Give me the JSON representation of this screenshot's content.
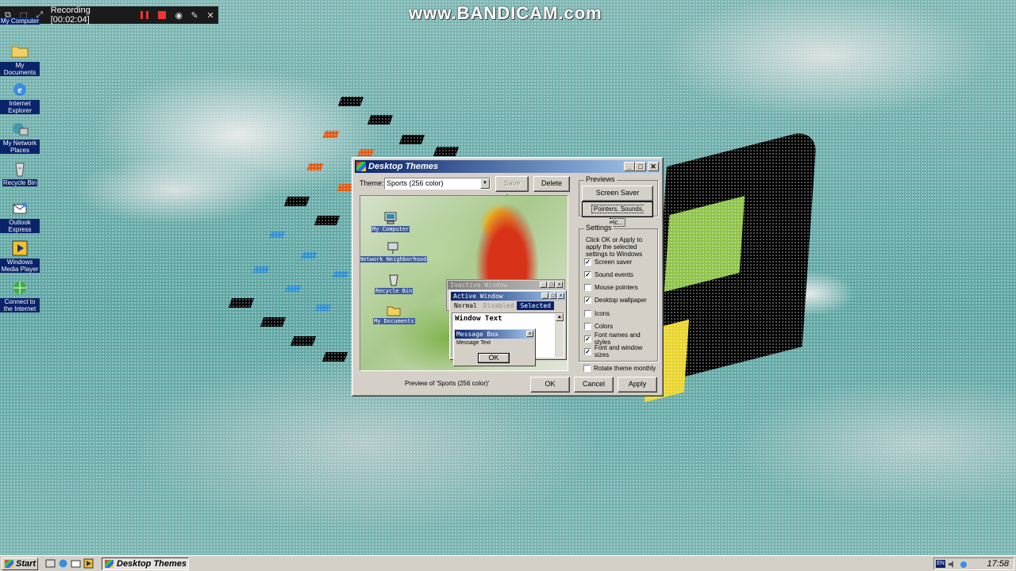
{
  "watermark": "www.BANDICAM.com",
  "recorder": {
    "status": "Recording [00:02:04]"
  },
  "desktop_icons": [
    {
      "label": "My Computer",
      "icon": "computer-icon"
    },
    {
      "label": "My Documents",
      "icon": "folder-icon"
    },
    {
      "label": "Internet Explorer",
      "icon": "ie-icon"
    },
    {
      "label": "My Network Places",
      "icon": "network-icon"
    },
    {
      "label": "Recycle Bin",
      "icon": "recycle-bin-icon"
    },
    {
      "label": "Outlook Express",
      "icon": "outlook-icon"
    },
    {
      "label": "Windows Media Player",
      "icon": "media-player-icon"
    },
    {
      "label": "Connect to the Internet",
      "icon": "connect-icon"
    }
  ],
  "window": {
    "title": "Desktop Themes",
    "theme_label": "Theme:",
    "theme_value": "Sports (256 color)",
    "save_as": "Save As...",
    "delete": "Delete",
    "previews_label": "Previews",
    "screen_saver": "Screen Saver",
    "pointers": "Pointers, Sounds, etc...",
    "settings_label": "Settings",
    "settings_desc": "Click OK or Apply to apply the selected settings to Windows",
    "settings": [
      {
        "label": "Screen saver",
        "checked": true
      },
      {
        "label": "Sound events",
        "checked": true
      },
      {
        "label": "Mouse pointers",
        "checked": false
      },
      {
        "label": "Desktop wallpaper",
        "checked": true
      },
      {
        "label": "Icons",
        "checked": false
      },
      {
        "label": "Colors",
        "checked": false
      },
      {
        "label": "Font names and styles",
        "checked": true
      },
      {
        "label": "Font and window sizes",
        "checked": true
      }
    ],
    "rotate": {
      "label": "Rotate theme monthly",
      "checked": false
    },
    "preview_caption": "Preview of 'Sports (256 color)'",
    "ok": "OK",
    "cancel": "Cancel",
    "apply": "Apply"
  },
  "preview": {
    "icons": [
      "My Computer",
      "Network Neighborhood",
      "Recycle Bin",
      "My Documents"
    ],
    "inactive_title": "Inactive Window",
    "active_title": "Active Window",
    "menu": {
      "normal": "Normal",
      "disabled": "Disabled",
      "selected": "Selected"
    },
    "window_text": "Window Text",
    "msgbox_title": "Message Box",
    "msgbox_text": "Message Text",
    "msgbox_ok": "OK"
  },
  "taskbar": {
    "start": "Start",
    "task": "Desktop Themes",
    "lang": "EN",
    "clock": "17:58"
  },
  "colors": {
    "title_active": "#0a246a",
    "face": "#d4d0c8",
    "desktop": "#6fb0ad"
  }
}
